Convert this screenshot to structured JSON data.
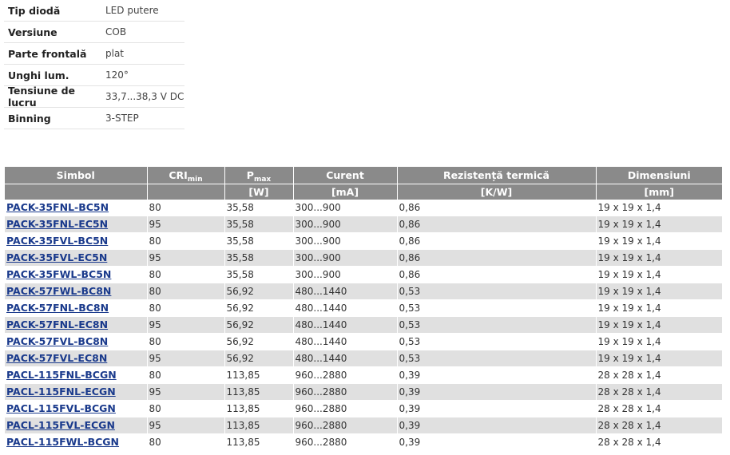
{
  "specs": [
    {
      "key": "Tip diodă",
      "value": "LED putere"
    },
    {
      "key": "Versiune",
      "value": "COB"
    },
    {
      "key": "Parte frontală",
      "value": "plat"
    },
    {
      "key": "Unghi lum.",
      "value": "120°"
    },
    {
      "key": "Tensiune de lucru",
      "value": "33,7...38,3 V DC"
    },
    {
      "key": "Binning",
      "value": "3-STEP"
    }
  ],
  "table": {
    "headers": {
      "simbol": "Simbol",
      "cri": "CRI",
      "cri_sub": "min",
      "pmax": "P",
      "pmax_sub": "max",
      "curent": "Curent",
      "rezistenta": "Rezistență termică",
      "dimensiuni": "Dimensiuni"
    },
    "units": {
      "simbol": "",
      "cri": "",
      "pmax": "[W]",
      "curent": "[mA]",
      "rezistenta": "[K/W]",
      "dimensiuni": "[mm]"
    },
    "rows": [
      {
        "simbol": "PACK-35FNL-BC5N",
        "cri": "80",
        "pmax": "35,58",
        "curent": "300...900",
        "rezistenta": "0,86",
        "dimensiuni": "19 x 19 x 1,4"
      },
      {
        "simbol": "PACK-35FNL-EC5N",
        "cri": "95",
        "pmax": "35,58",
        "curent": "300...900",
        "rezistenta": "0,86",
        "dimensiuni": "19 x 19 x 1,4"
      },
      {
        "simbol": "PACK-35FVL-BC5N",
        "cri": "80",
        "pmax": "35,58",
        "curent": "300...900",
        "rezistenta": "0,86",
        "dimensiuni": "19 x 19 x 1,4"
      },
      {
        "simbol": "PACK-35FVL-EC5N",
        "cri": "95",
        "pmax": "35,58",
        "curent": "300...900",
        "rezistenta": "0,86",
        "dimensiuni": "19 x 19 x 1,4"
      },
      {
        "simbol": "PACK-35FWL-BC5N",
        "cri": "80",
        "pmax": "35,58",
        "curent": "300...900",
        "rezistenta": "0,86",
        "dimensiuni": "19 x 19 x 1,4"
      },
      {
        "simbol": "PACK-57FWL-BC8N",
        "cri": "80",
        "pmax": "56,92",
        "curent": "480...1440",
        "rezistenta": "0,53",
        "dimensiuni": "19 x 19 x 1,4"
      },
      {
        "simbol": "PACK-57FNL-BC8N",
        "cri": "80",
        "pmax": "56,92",
        "curent": "480...1440",
        "rezistenta": "0,53",
        "dimensiuni": "19 x 19 x 1,4"
      },
      {
        "simbol": "PACK-57FNL-EC8N",
        "cri": "95",
        "pmax": "56,92",
        "curent": "480...1440",
        "rezistenta": "0,53",
        "dimensiuni": "19 x 19 x 1,4"
      },
      {
        "simbol": "PACK-57FVL-BC8N",
        "cri": "80",
        "pmax": "56,92",
        "curent": "480...1440",
        "rezistenta": "0,53",
        "dimensiuni": "19 x 19 x 1,4"
      },
      {
        "simbol": "PACK-57FVL-EC8N",
        "cri": "95",
        "pmax": "56,92",
        "curent": "480...1440",
        "rezistenta": "0,53",
        "dimensiuni": "19 x 19 x 1,4"
      },
      {
        "simbol": "PACL-115FNL-BCGN",
        "cri": "80",
        "pmax": "113,85",
        "curent": "960...2880",
        "rezistenta": "0,39",
        "dimensiuni": "28 x 28 x 1,4"
      },
      {
        "simbol": "PACL-115FNL-ECGN",
        "cri": "95",
        "pmax": "113,85",
        "curent": "960...2880",
        "rezistenta": "0,39",
        "dimensiuni": "28 x 28 x 1,4"
      },
      {
        "simbol": "PACL-115FVL-BCGN",
        "cri": "80",
        "pmax": "113,85",
        "curent": "960...2880",
        "rezistenta": "0,39",
        "dimensiuni": "28 x 28 x 1,4"
      },
      {
        "simbol": "PACL-115FVL-ECGN",
        "cri": "95",
        "pmax": "113,85",
        "curent": "960...2880",
        "rezistenta": "0,39",
        "dimensiuni": "28 x 28 x 1,4"
      },
      {
        "simbol": "PACL-115FWL-BCGN",
        "cri": "80",
        "pmax": "113,85",
        "curent": "960...2880",
        "rezistenta": "0,39",
        "dimensiuni": "28 x 28 x 1,4"
      }
    ]
  },
  "colors": {
    "header_bg": "#8a8a8a",
    "row_alt_bg": "#e0e0e0",
    "link": "#1a3a8c"
  }
}
